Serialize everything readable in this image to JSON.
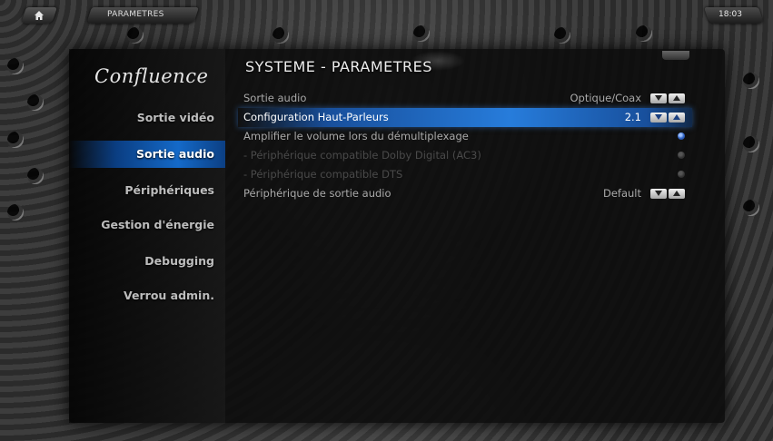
{
  "topbar": {
    "breadcrumb": "PARAMETRES",
    "clock": "18:03"
  },
  "sidebar": {
    "logo": "Confluence",
    "items": [
      {
        "label": "Sortie vidéo",
        "selected": false
      },
      {
        "label": "Sortie audio",
        "selected": true
      },
      {
        "label": "Périphériques",
        "selected": false
      },
      {
        "label": "Gestion d'énergie",
        "selected": false
      },
      {
        "label": "Debugging",
        "selected": false
      },
      {
        "label": "Verrou admin.",
        "selected": false
      }
    ]
  },
  "main": {
    "title": "SYSTEME - PARAMETRES",
    "settings": [
      {
        "label": "Sortie audio",
        "value": "Optique/Coax",
        "control": "spinner",
        "state": "normal"
      },
      {
        "label": "Configuration Haut-Parleurs",
        "value": "2.1",
        "control": "spinner",
        "state": "focused"
      },
      {
        "label": "Amplifier le volume lors du démultiplexage",
        "value": "",
        "control": "radio",
        "state": "normal"
      },
      {
        "label": "- Périphérique compatible Dolby Digital (AC3)",
        "value": "",
        "control": "radio",
        "state": "disabled"
      },
      {
        "label": "- Périphérique compatible DTS",
        "value": "",
        "control": "radio",
        "state": "disabled"
      },
      {
        "label": "Périphérique de sortie audio",
        "value": "Default",
        "control": "spinner",
        "state": "normal"
      }
    ]
  },
  "colors": {
    "selection_blue": "#1e6ed2",
    "panel_bg": "#0c0c0c",
    "text_normal": "#a9a9a9",
    "text_disabled": "#4a4a4a"
  },
  "icons": {
    "home": "home-icon",
    "spinner_down": "arrow-down-icon",
    "spinner_up": "arrow-up-icon",
    "radio": "radio-button-icon"
  }
}
